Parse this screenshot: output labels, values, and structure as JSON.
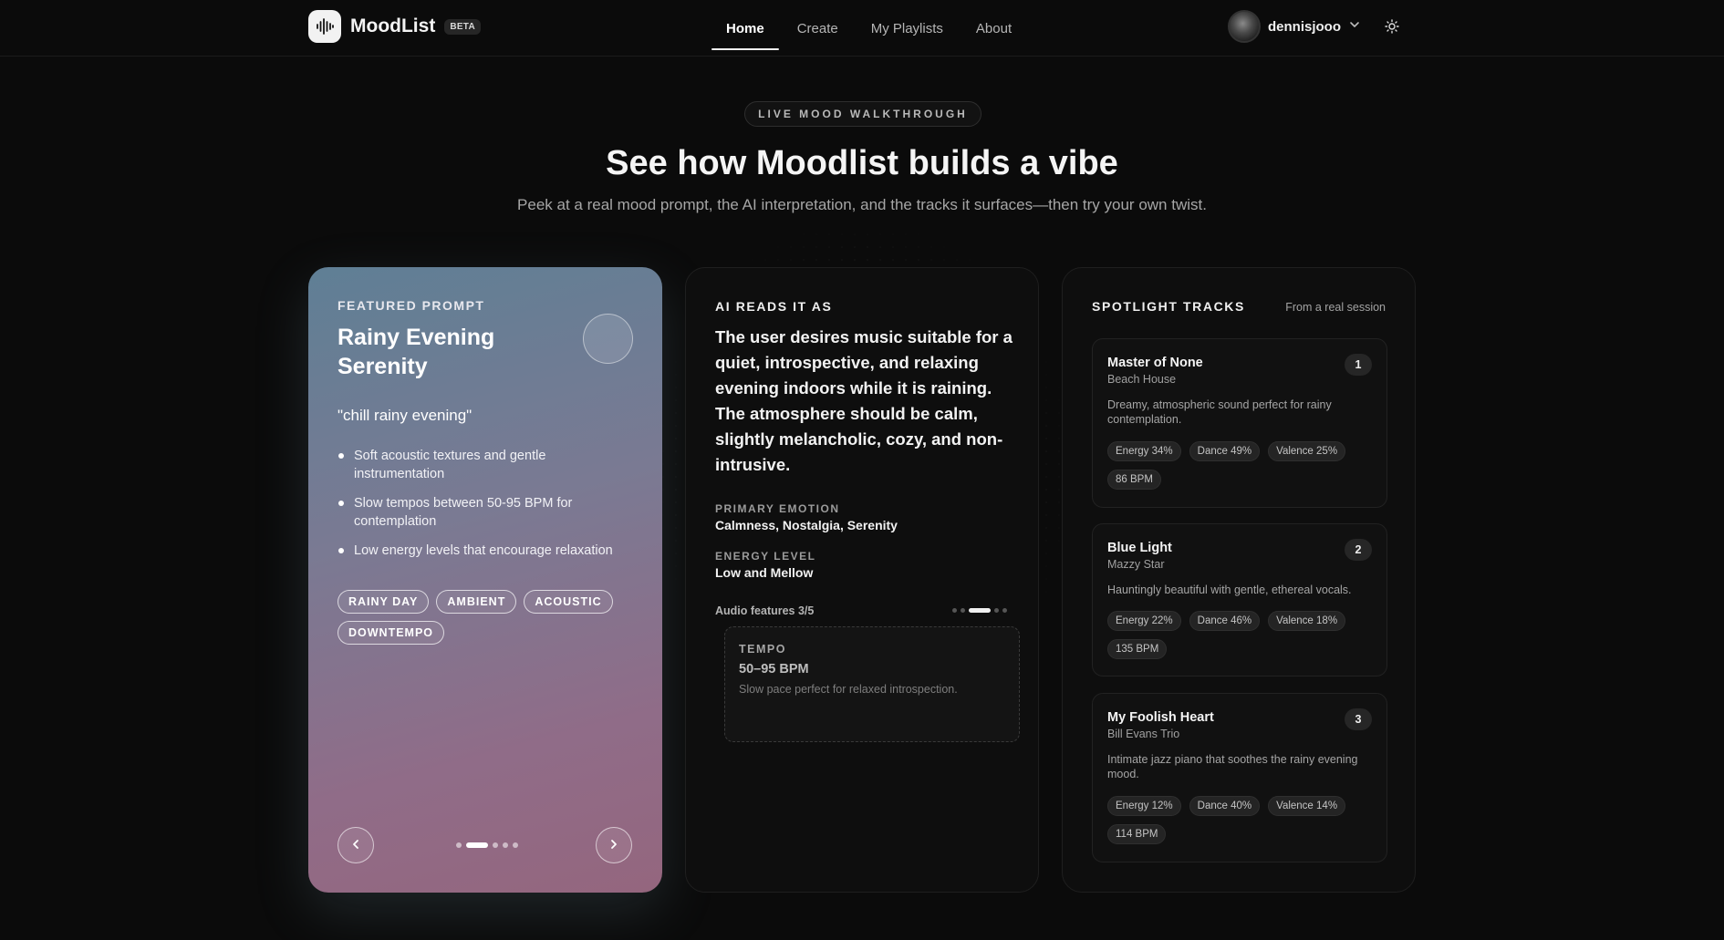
{
  "nav": {
    "brand": "MoodList",
    "badge": "BETA",
    "links": [
      {
        "label": "Home",
        "active": true
      },
      {
        "label": "Create"
      },
      {
        "label": "My Playlists"
      },
      {
        "label": "About"
      }
    ],
    "username": "dennisjooo"
  },
  "hero": {
    "pill": "LIVE MOOD WALKTHROUGH",
    "title": "See how Moodlist builds a vibe",
    "subtitle": "Peek at a real mood prompt, the AI interpretation, and the tracks it surfaces—then try your own twist."
  },
  "featured": {
    "label": "FEATURED PROMPT",
    "title": "Rainy Evening Serenity",
    "quote": "\"chill rainy evening\"",
    "bullets": [
      "Soft acoustic textures and gentle instrumentation",
      "Slow tempos between 50-95 BPM for contemplation",
      "Low energy levels that encourage relaxation"
    ],
    "tags": [
      "RAINY DAY",
      "AMBIENT",
      "ACOUSTIC",
      "DOWNTEMPO"
    ],
    "carousel": {
      "total": 5,
      "active": 2
    }
  },
  "ai": {
    "label": "AI READS IT AS",
    "text": "The user desires music suitable for a quiet, introspective, and relaxing evening indoors while it is raining. The atmosphere should be calm, slightly melancholic, cozy, and non-intrusive.",
    "primary_emotion_label": "PRIMARY EMOTION",
    "primary_emotion": "Calmness, Nostalgia, Serenity",
    "energy_label": "ENERGY LEVEL",
    "energy": "Low and Mellow",
    "features_label": "Audio features 3/5",
    "features_total": 5,
    "features_active": 3,
    "feature_card": {
      "label": "TEMPO",
      "value": "50–95 BPM",
      "desc": "Slow pace perfect for relaxed introspection."
    }
  },
  "spotlight": {
    "label": "SPOTLIGHT TRACKS",
    "meta": "From a real session",
    "tracks": [
      {
        "rank": "1",
        "name": "Master of None",
        "artist": "Beach House",
        "desc": "Dreamy, atmospheric sound perfect for rainy contemplation.",
        "chips": [
          "Energy 34%",
          "Dance 49%",
          "Valence 25%",
          "86 BPM"
        ]
      },
      {
        "rank": "2",
        "name": "Blue Light",
        "artist": "Mazzy Star",
        "desc": "Hauntingly beautiful with gentle, ethereal vocals.",
        "chips": [
          "Energy 22%",
          "Dance 46%",
          "Valence 18%",
          "135 BPM"
        ]
      },
      {
        "rank": "3",
        "name": "My Foolish Heart",
        "artist": "Bill Evans Trio",
        "desc": "Intimate jazz piano that soothes the rainy evening mood.",
        "chips": [
          "Energy 12%",
          "Dance 40%",
          "Valence 14%",
          "114 BPM"
        ]
      }
    ]
  }
}
